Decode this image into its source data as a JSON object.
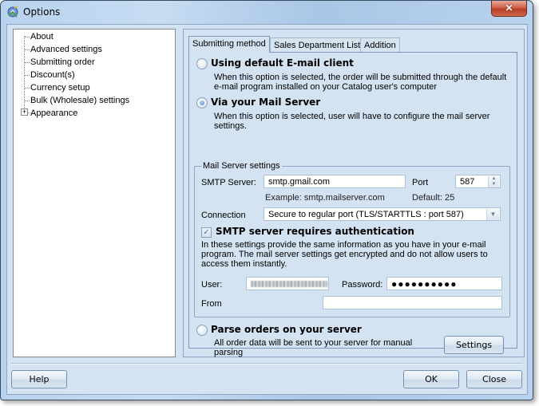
{
  "window": {
    "title": "Options",
    "close_glyph": "✕"
  },
  "sidebar": {
    "items": [
      {
        "label": "About",
        "expandable": false
      },
      {
        "label": "Advanced settings",
        "expandable": false
      },
      {
        "label": "Submitting order",
        "expandable": false
      },
      {
        "label": "Discount(s)",
        "expandable": false
      },
      {
        "label": "Currency setup",
        "expandable": false
      },
      {
        "label": "Bulk (Wholesale) settings",
        "expandable": false
      },
      {
        "label": "Appearance",
        "expandable": true
      }
    ],
    "expander_glyph": "+"
  },
  "tabs": [
    {
      "label": "Submitting method",
      "active": true
    },
    {
      "label": "Sales Department List",
      "active": false
    },
    {
      "label": "Addition",
      "active": false
    }
  ],
  "submitting": {
    "option_default_client": {
      "label": "Using default E-mail client",
      "selected": false,
      "description": "When this option is selected, the order will be submitted through the default e-mail program installed on your Catalog user's computer"
    },
    "option_mail_server": {
      "label": "Via your Mail Server",
      "selected": true,
      "description": "When this option is selected, user will have to configure the mail server settings."
    },
    "option_parse_server": {
      "label": "Parse orders on your server",
      "selected": false,
      "description": "All order data will be sent to your server for manual parsing"
    },
    "settings_button": "Settings"
  },
  "mail_server": {
    "group_title": "Mail Server settings",
    "smtp_label": "SMTP Server:",
    "smtp_value": "smtp.gmail.com",
    "smtp_example": "Example: smtp.mailserver.com",
    "port_label": "Port",
    "port_value": "587",
    "port_default": "Default: 25",
    "connection_label": "Connection",
    "connection_value": "Secure to regular port (TLS/STARTTLS : port 587)",
    "auth_checkbox_label": "SMTP server requires authentication",
    "auth_checked": true,
    "auth_description": "In these settings provide the same information as you have in your e-mail program. The mail server settings get encrypted and do not allow users to access them instantly.",
    "user_label": "User:",
    "password_label": "Password:",
    "password_value": "●●●●●●●●●●",
    "from_label": "From",
    "from_value": ""
  },
  "footer": {
    "help": "Help",
    "ok": "OK",
    "close": "Close"
  }
}
